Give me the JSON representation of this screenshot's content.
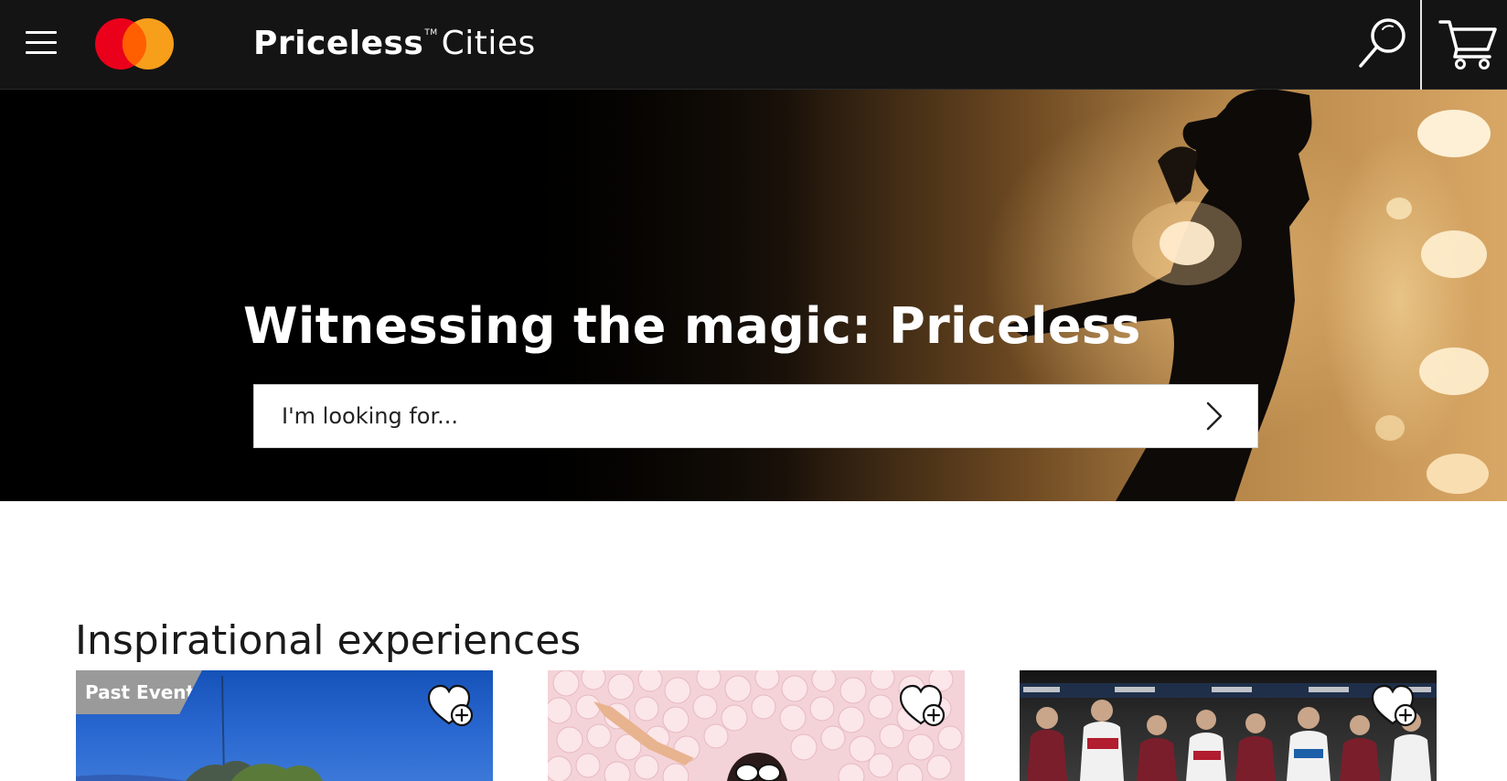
{
  "header": {
    "brand_bold": "Priceless",
    "brand_tm": "TM",
    "brand_light": "Cities",
    "icons": [
      "menu-icon",
      "mastercard-logo",
      "search-icon",
      "cart-icon"
    ],
    "logo_colors": {
      "left": "#eb001b",
      "right": "#f79e1b",
      "overlap": "#ff5f00"
    }
  },
  "hero": {
    "title": "Witnessing the magic: Priceless",
    "search": {
      "placeholder": "I'm looking for...",
      "value": ""
    }
  },
  "section": {
    "title": "Inspirational experiences"
  },
  "cards": [
    {
      "badge": "Past Event",
      "icon": "heart-plus-icon"
    },
    {
      "badge": "",
      "icon": "heart-plus-icon"
    },
    {
      "badge": "",
      "icon": "heart-plus-icon"
    }
  ]
}
